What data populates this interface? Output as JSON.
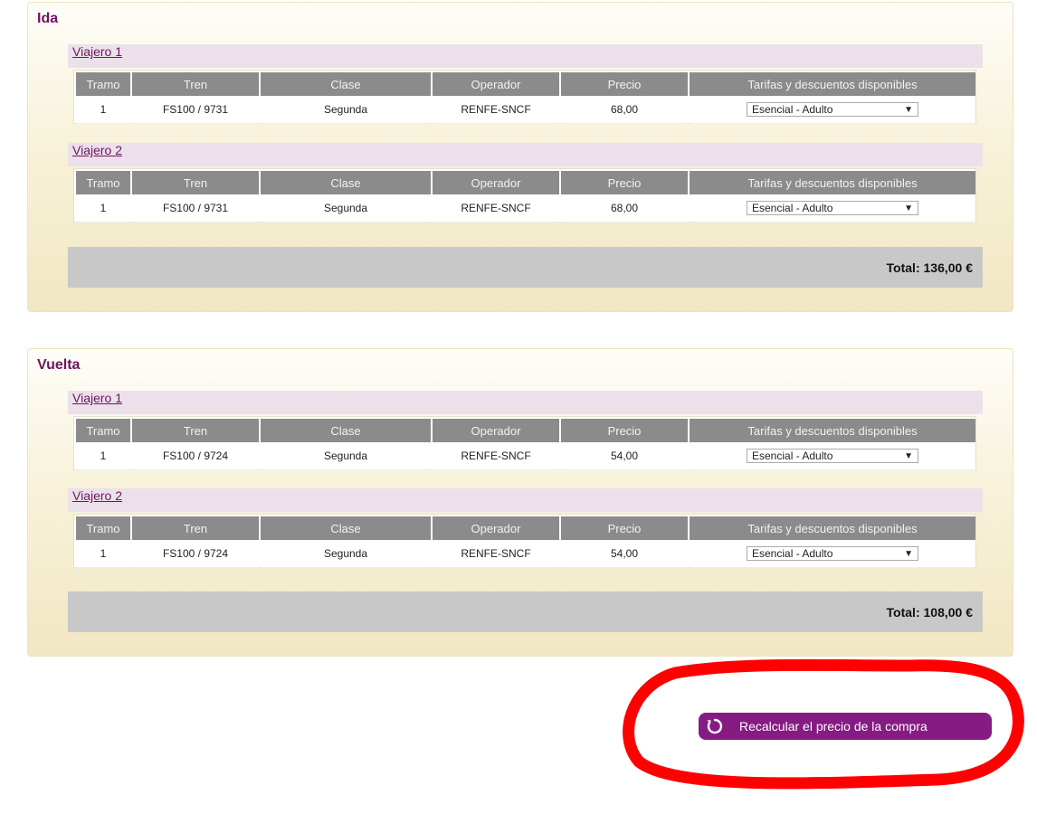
{
  "legs_header": {
    "tramo": "Tramo",
    "tren": "Tren",
    "clase": "Clase",
    "operador": "Operador",
    "precio": "Precio",
    "tarifas": "Tarifas y descuentos disponibles"
  },
  "ida": {
    "title": "Ida",
    "travelers": [
      {
        "label": "Viajero 1",
        "leg": {
          "tramo": "1",
          "tren": "FS100 / 9731",
          "clase": "Segunda",
          "operador": "RENFE-SNCF",
          "precio": "68,00",
          "tarifa": "Esencial - Adulto"
        }
      },
      {
        "label": "Viajero 2",
        "leg": {
          "tramo": "1",
          "tren": "FS100 / 9731",
          "clase": "Segunda",
          "operador": "RENFE-SNCF",
          "precio": "68,00",
          "tarifa": "Esencial - Adulto"
        }
      }
    ],
    "total": "Total: 136,00 €"
  },
  "vuelta": {
    "title": "Vuelta",
    "travelers": [
      {
        "label": "Viajero 1",
        "leg": {
          "tramo": "1",
          "tren": "FS100 / 9724",
          "clase": "Segunda",
          "operador": "RENFE-SNCF",
          "precio": "54,00",
          "tarifa": "Esencial - Adulto"
        }
      },
      {
        "label": "Viajero 2",
        "leg": {
          "tramo": "1",
          "tren": "FS100 / 9724",
          "clase": "Segunda",
          "operador": "RENFE-SNCF",
          "precio": "54,00",
          "tarifa": "Esencial - Adulto"
        }
      }
    ],
    "total": "Total: 108,00 €"
  },
  "recalc_button": {
    "label": "Recalcular el precio de la compra",
    "icon": "refresh-icon"
  },
  "colors": {
    "accent_purple": "#861b83",
    "title_purple": "#6e1463",
    "highlight_red": "#ff0000"
  }
}
